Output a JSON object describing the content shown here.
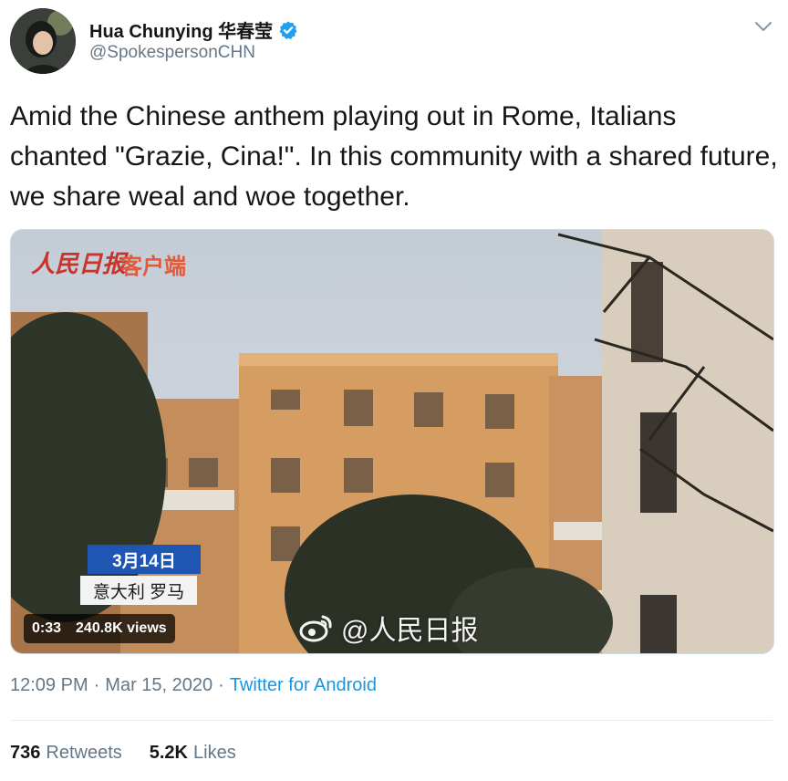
{
  "author": {
    "name": "Hua Chunying 华春莹",
    "handle": "@SpokespersonCHN",
    "verified": true
  },
  "tweet": {
    "text": "Amid the Chinese anthem playing out in Rome, Italians chanted \"Grazie, Cina!\". In this community with a shared future, we share weal and woe together."
  },
  "media": {
    "watermark_logo": "人民日报",
    "watermark_client": "客户端",
    "date_badge": "3月14日",
    "location_badge": "意大利 罗马",
    "duration": "0:33",
    "views": "240.8K views",
    "weibo_watermark": "@人民日报"
  },
  "meta": {
    "time": "12:09 PM",
    "sep1": "·",
    "date": "Mar 15, 2020",
    "sep2": "·",
    "source": "Twitter for Android"
  },
  "stats": {
    "retweets_count": "736",
    "retweets_label": "Retweets",
    "likes_count": "5.2K",
    "likes_label": "Likes"
  },
  "colors": {
    "link": "#1b95e0",
    "verified": "#1da1f2",
    "muted": "#657786"
  },
  "icons": [
    "verified-badge-icon",
    "chevron-down-icon",
    "weibo-icon"
  ]
}
